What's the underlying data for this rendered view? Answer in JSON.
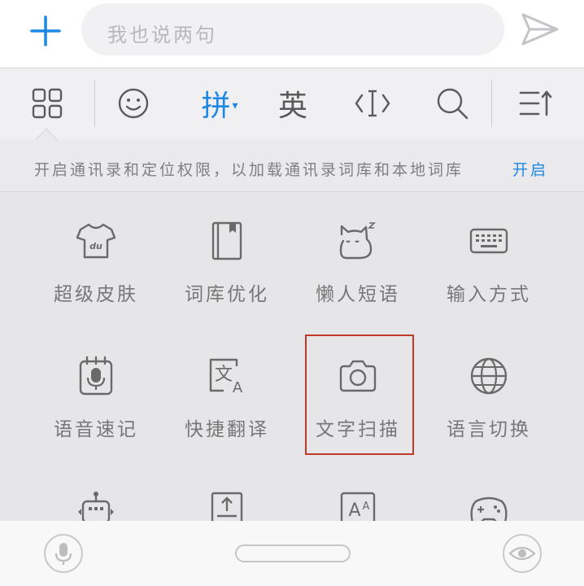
{
  "input": {
    "placeholder": "我也说两句"
  },
  "toolbar": {
    "pinyin_label": "拼",
    "pinyin_dropdown": "▾",
    "english_label": "英"
  },
  "notice": {
    "message": "开启通讯录和定位权限，以加载通讯录词库和本地词库",
    "action": "开启"
  },
  "grid": {
    "items": [
      {
        "label": "超级皮肤",
        "icon": "tshirt-icon"
      },
      {
        "label": "词库优化",
        "icon": "book-icon"
      },
      {
        "label": "懒人短语",
        "icon": "sleeping-cat-icon"
      },
      {
        "label": "输入方式",
        "icon": "keyboard-icon"
      },
      {
        "label": "语音速记",
        "icon": "voice-notepad-icon"
      },
      {
        "label": "快捷翻译",
        "icon": "translate-icon"
      },
      {
        "label": "文字扫描",
        "icon": "camera-icon"
      },
      {
        "label": "语言切换",
        "icon": "globe-icon"
      }
    ]
  },
  "colors": {
    "accent": "#1e88e5",
    "highlight": "#c0392b"
  }
}
